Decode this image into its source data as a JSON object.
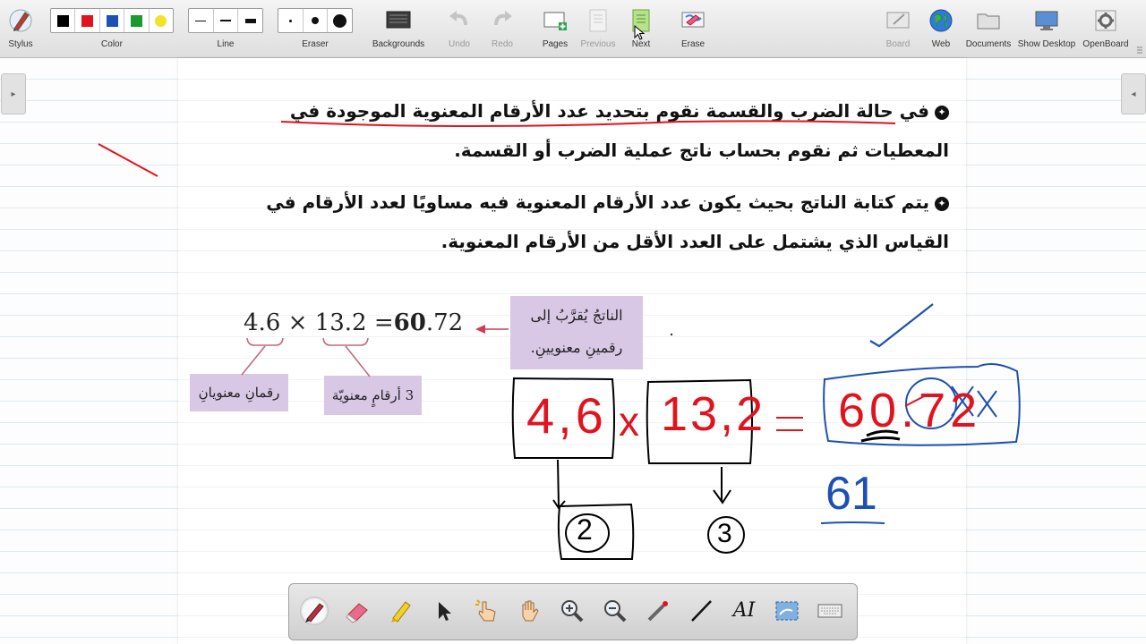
{
  "toolbar": {
    "stylus_label": "Stylus",
    "color_label": "Color",
    "colors": [
      "#000000",
      "#e0141e",
      "#1c50b4",
      "#1a9a2e",
      "#f3e22a"
    ],
    "line_label": "Line",
    "eraser_label": "Eraser",
    "backgrounds_label": "Backgrounds",
    "undo_label": "Undo",
    "redo_label": "Redo",
    "pages_label": "Pages",
    "previous_label": "Previous",
    "next_label": "Next",
    "erase_label": "Erase",
    "board_label": "Board",
    "web_label": "Web",
    "documents_label": "Documents",
    "show_desktop_label": "Show Desktop",
    "openboard_label": "OpenBoard"
  },
  "content": {
    "bullet1_line1_prefix": "في حالة الضرب والقسمة ",
    "bullet1_line1_underlined": "نقوم بتحديد عدد الأرقام المعنوية الموجودة",
    "bullet1_line1_suffix": " في",
    "bullet1_line2": "المعطيات ثم نقوم بحساب ناتج عملية الضرب أو القسمة.",
    "bullet2_line1": "يتم كتابة الناتج بحيث يكون عدد الأرقام المعنوية فيه مساويًا لعدد الأرقام في",
    "bullet2_line2": "القياس الذي يشتمل على العدد الأقل من الأرقام المعنوية.",
    "eq_a": "4.6",
    "eq_times": "×",
    "eq_b": "13.2",
    "eq_equals": "=",
    "eq_result_bold": "60",
    "eq_result_rest": ".72",
    "box_result_line1": "الناتجُ يُقرَّبُ إلى",
    "box_result_line2": "رقمينِ معنويينِ.",
    "box_two_digits": "رقمانِ معنويانِ",
    "box_three_digits": "3 أرقامٍ معنويّة"
  },
  "handwriting": {
    "n1": "4,6",
    "times": "x",
    "n2": "13,2",
    "equals": "=",
    "result": "60.72",
    "sf1": "2",
    "sf2": "3",
    "rounded": "61"
  },
  "bottom_tools": [
    "pen-tool",
    "eraser-tool",
    "marker-tool",
    "selector-tool",
    "interact-tool",
    "hand-tool",
    "zoom-in-tool",
    "zoom-out-tool",
    "laser-pointer-tool",
    "line-tool",
    "text-tool",
    "capture-tool",
    "keyboard-tool"
  ]
}
